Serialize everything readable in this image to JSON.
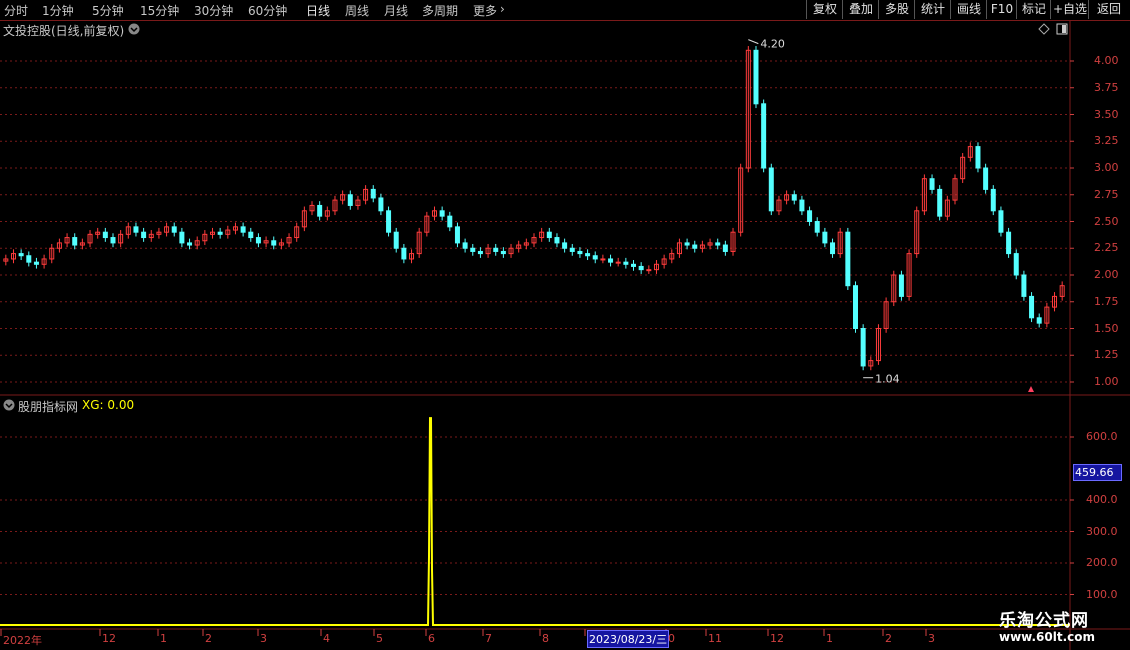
{
  "toolbar": {
    "periods": [
      "分时",
      "1分钟",
      "5分钟",
      "15分钟",
      "30分钟",
      "60分钟",
      "日线",
      "周线",
      "月线",
      "多周期",
      "更多"
    ],
    "active_period": "日线",
    "more_arrow": "›",
    "right_buttons": [
      "复权",
      "叠加",
      "多股",
      "统计",
      "画线",
      "F10",
      "标记",
      "+自选",
      "返回"
    ]
  },
  "main_chart": {
    "title": "文投控股(日线,前复权)",
    "y_ticks": [
      "4.00",
      "3.75",
      "3.50",
      "3.25",
      "3.00",
      "2.75",
      "2.50",
      "2.25",
      "2.00",
      "1.75",
      "1.50",
      "1.25",
      "1.00"
    ],
    "high_label": "4.20",
    "low_label": "1.04"
  },
  "indicator": {
    "name": "股朋指标网",
    "xg_label": "XG: 0.00",
    "y_ticks": [
      "600.0",
      "400.0",
      "300.0",
      "200.0",
      "100.0"
    ],
    "current_badge": "459.66"
  },
  "time_axis": {
    "labels": [
      "2022年",
      "12",
      "1",
      "2",
      "3",
      "4",
      "5",
      "6",
      "7",
      "8",
      "2023/08/23/三",
      "0",
      "11",
      "12",
      "1",
      "2",
      "3"
    ]
  },
  "watermark": {
    "line1": "乐淘公式网",
    "line2": "www.60lt.com"
  },
  "colors": {
    "up": "#ff3c3c",
    "down": "#54ffff",
    "grid": "#7a1a1a",
    "indicator_line": "#ffff00"
  },
  "chart_data": {
    "type": "candlestick",
    "title": "文投控股(日线,前复权)",
    "price_range": [
      1.0,
      4.2
    ],
    "high": 4.2,
    "low": 1.04,
    "close_series": [
      2.15,
      2.2,
      2.18,
      2.12,
      2.1,
      2.15,
      2.25,
      2.3,
      2.35,
      2.28,
      2.3,
      2.38,
      2.4,
      2.35,
      2.3,
      2.38,
      2.45,
      2.4,
      2.35,
      2.38,
      2.4,
      2.45,
      2.4,
      2.3,
      2.28,
      2.32,
      2.38,
      2.4,
      2.38,
      2.42,
      2.45,
      2.4,
      2.35,
      2.3,
      2.32,
      2.28,
      2.3,
      2.35,
      2.45,
      2.6,
      2.65,
      2.55,
      2.6,
      2.7,
      2.75,
      2.65,
      2.7,
      2.8,
      2.72,
      2.6,
      2.4,
      2.25,
      2.15,
      2.2,
      2.4,
      2.55,
      2.6,
      2.55,
      2.45,
      2.3,
      2.25,
      2.22,
      2.2,
      2.25,
      2.22,
      2.2,
      2.25,
      2.28,
      2.3,
      2.35,
      2.4,
      2.35,
      2.3,
      2.25,
      2.22,
      2.2,
      2.18,
      2.15,
      2.15,
      2.12,
      2.12,
      2.1,
      2.08,
      2.05,
      2.05,
      2.1,
      2.15,
      2.2,
      2.3,
      2.28,
      2.25,
      2.28,
      2.3,
      2.28,
      2.22,
      2.4,
      3.0,
      4.1,
      3.6,
      3.0,
      2.6,
      2.7,
      2.75,
      2.7,
      2.6,
      2.5,
      2.4,
      2.3,
      2.2,
      2.4,
      1.9,
      1.5,
      1.15,
      1.2,
      1.5,
      1.75,
      2.0,
      1.8,
      2.2,
      2.6,
      2.9,
      2.8,
      2.55,
      2.7,
      2.9,
      3.1,
      3.2,
      3.0,
      2.8,
      2.6,
      2.4,
      2.2,
      2.0,
      1.8,
      1.6,
      1.55,
      1.7,
      1.8,
      1.9
    ],
    "indicator": {
      "name": "股朋指标网",
      "range": [
        0,
        700
      ],
      "spike_value": 660,
      "current_value": 459.66
    },
    "x_labels": [
      "2022年",
      "12",
      "1",
      "2",
      "3",
      "4",
      "5",
      "6",
      "7",
      "8",
      "2023/08/23/三",
      "0",
      "11",
      "12",
      "1",
      "2",
      "3"
    ]
  }
}
